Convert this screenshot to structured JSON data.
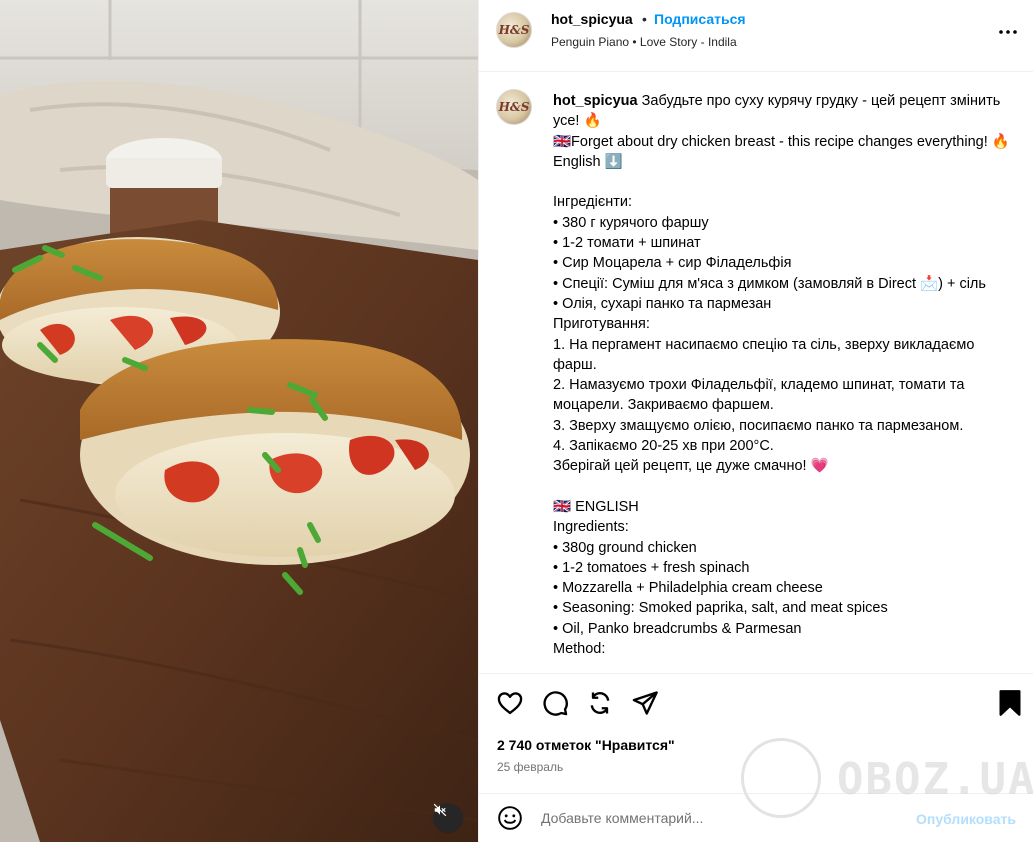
{
  "header": {
    "username": "hot_spicyua",
    "separator": "•",
    "follow_label": "Подписаться",
    "music": "Penguin Piano • Love Story - Indila",
    "avatar_text": "H&S"
  },
  "caption": {
    "username": "hot_spicyua",
    "text": " Забудьте про суху курячу грудку - цей рецепт змінить усе! 🔥\n🇬🇧Forget about dry chicken breast - this recipe changes everything! 🔥 English ⬇️\n\nІнгредієнти:\n• 380 г курячого фаршу\n• 1-2 томати + шпинат\n• Сир Моцарела + сир Філадельфія\n• Спеції: Суміш для м'яса з димком (замовляй в Direct 📩) + сіль\n• Олія, сухарі панко та пармезан\nПриготування:\n1. На пергамент насипаємо спецію та сіль, зверху викладаємо фарш.\n2. Намазуємо трохи Філадельфії, кладемо шпинат, томати та моцарели. Закриваємо фаршем.\n3. Зверху змащуємо олією, посипаємо панко та пармезаном.\n4. Запікаємо 20-25 хв при 200°C.\nЗберігай цей рецепт, це дуже смачно! 💗\n\n🇬🇧 ENGLISH\nIngredients:\n• 380g ground chicken\n• 1-2 tomatoes + fresh spinach\n• Mozzarella + Philadelphia cream cheese\n• Seasoning: Smoked paprika, salt, and meat spices\n• Oil, Panko breadcrumbs & Parmesan\nMethod:"
  },
  "stats": {
    "likes": "2 740 отметок \"Нравится\"",
    "date": "25 февраль"
  },
  "comment": {
    "placeholder": "Добавьте комментарий...",
    "publish_label": "Опубликовать"
  },
  "watermark": "OBOZ.UA",
  "colors": {
    "follow": "#0095f6",
    "publish_disabled": "#b2dffc",
    "secondary_text": "#737373",
    "border": "#efefef"
  },
  "icons": [
    "more-icon",
    "heart-icon",
    "comment-icon",
    "share-icon",
    "send-icon",
    "bookmark-icon",
    "emoji-icon",
    "mute-icon"
  ]
}
